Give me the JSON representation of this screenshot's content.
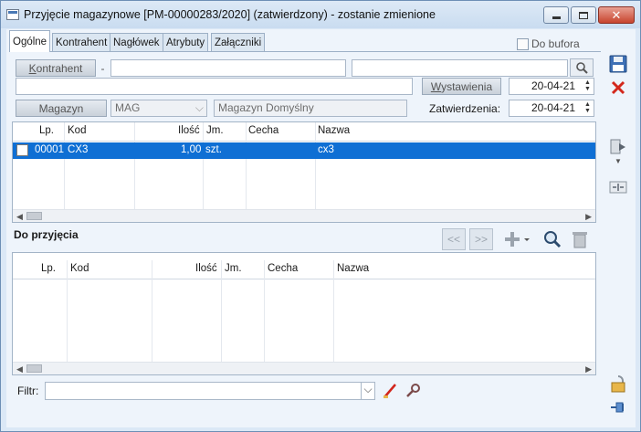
{
  "window": {
    "title": "Przyjęcie magazynowe [PM-00000283/2020] (zatwierdzony) - zostanie zmienione",
    "close_label": "✕"
  },
  "tabs": [
    "Ogólne",
    "Kontrahent",
    "Nagłówek",
    "Atrybuty",
    "Załączniki"
  ],
  "header": {
    "do_bufora_label": "Do bufora",
    "kontrahent_button": "Kontrahent",
    "kontrahent_dash": "-",
    "wystawienia_button": "Wystawienia",
    "wystawienia_date": "20-04-21",
    "magazyn_button": "Magazyn",
    "magazyn_code": "MAG",
    "magazyn_name": "Magazyn Domyślny",
    "zatwierdzenia_label": "Zatwierdzenia:",
    "zatwierdzenia_date": "20-04-21"
  },
  "items_grid": {
    "columns": [
      "Lp.",
      "Kod",
      "Ilość",
      "Jm.",
      "Cecha",
      "Nazwa"
    ],
    "rows": [
      {
        "lp": "00001",
        "kod": "CX3",
        "ilosc": "1,00",
        "jm": "szt.",
        "cecha": "",
        "nazwa": "cx3"
      }
    ]
  },
  "receipt_section": {
    "title": "Do przyjęcia",
    "prev_label": "<<",
    "next_label": ">>",
    "columns": [
      "Lp.",
      "Kod",
      "Ilość",
      "Jm.",
      "Cecha",
      "Nazwa"
    ]
  },
  "filter": {
    "label": "Filtr:",
    "value": ""
  },
  "colors": {
    "selection": "#0f6fd4",
    "window_bg": "#dbe8f6"
  }
}
